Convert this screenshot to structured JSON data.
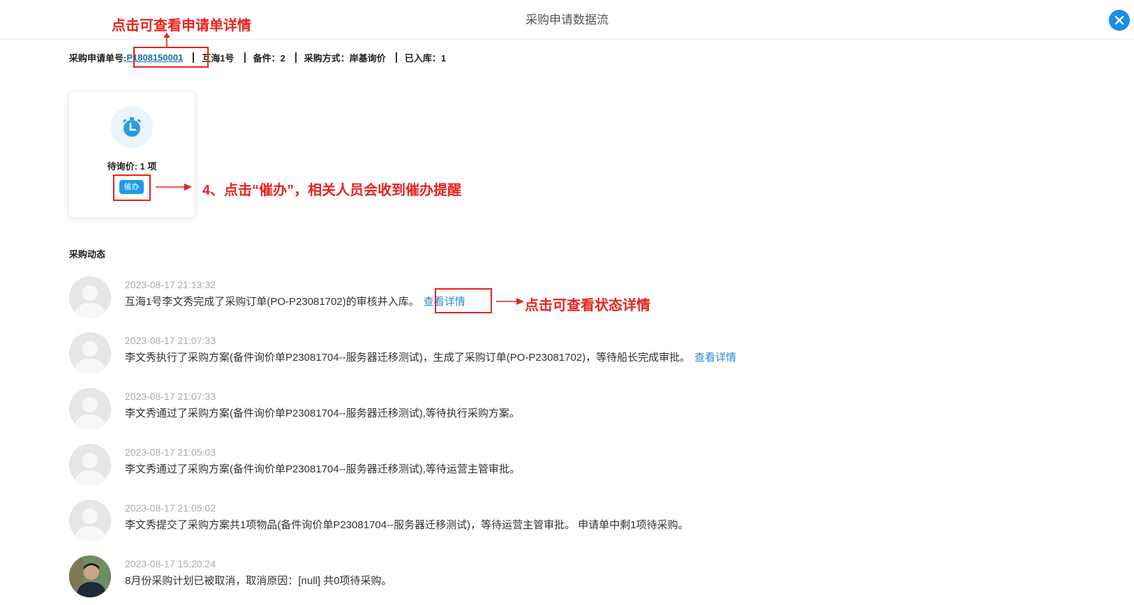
{
  "header": {
    "title": "采购申请数据流",
    "close_icon": "close-icon"
  },
  "annotations": {
    "order_hint": "点击可查看申请单详情",
    "urge_hint": "4、点击“催办”，相关人员会收到催办提醒",
    "detail_hint": "点击可查看状态详情",
    "color": "#e8231f"
  },
  "info": {
    "order_label": "采购申请单号:",
    "order_no": "P1808150001",
    "ship": "互海1号",
    "spare_parts": "备件：2",
    "method": "采购方式：岸基询价",
    "in_stock": "已入库：1"
  },
  "status_card": {
    "icon": "clock-icon",
    "pending_label": "待询价: 1 项",
    "urge_button": "催办",
    "accent": "#1a9de8"
  },
  "activity_section": {
    "title": "采购动态",
    "items": [
      {
        "time": "2023-08-17 21:13:32",
        "text": "互海1号李文秀完成了采购订单(PO-P23081702)的审核并入库。",
        "link": "查看详情",
        "avatar": "default-avatar"
      },
      {
        "time": "2023-08-17 21:07:33",
        "text": "李文秀执行了采购方案(备件询价单P23081704--服务器迁移测试)，生成了采购订单(PO-P23081702)，等待船长完成审批。",
        "link": "查看详情",
        "avatar": "default-avatar"
      },
      {
        "time": "2023-08-17 21:07:33",
        "text": "李文秀通过了采购方案(备件询价单P23081704--服务器迁移测试),等待执行采购方案。",
        "link": "",
        "avatar": "default-avatar"
      },
      {
        "time": "2023-08-17 21:05:03",
        "text": "李文秀通过了采购方案(备件询价单P23081704--服务器迁移测试),等待运营主管审批。",
        "link": "",
        "avatar": "default-avatar"
      },
      {
        "time": "2023-08-17 21:05:02",
        "text": "李文秀提交了采购方案共1项物品(备件询价单P23081704--服务器迁移测试)，等待运营主管审批。 申请单中剩1项待采购。",
        "link": "",
        "avatar": "default-avatar"
      },
      {
        "time": "2023-08-17 15:20:24",
        "text": "8月份采购计划已被取消，取消原因：[null] 共0项待采购。",
        "link": "",
        "avatar": "user-photo-avatar"
      }
    ]
  }
}
